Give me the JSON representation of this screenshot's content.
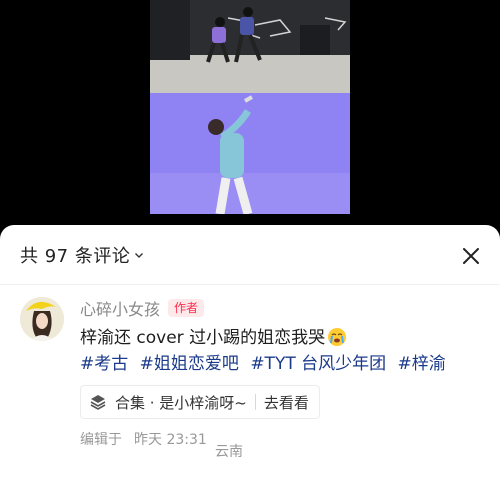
{
  "comments_header": {
    "count_label": "共 97 条评论",
    "dropdown_icon": "chevron-down-icon",
    "close_icon": "close-icon"
  },
  "comment": {
    "username": "心碎小女孩",
    "badge": "作者",
    "text": "梓渝还 cover 过小踢的姐恋我哭",
    "emoji": "crying-face",
    "tags": [
      "#考古",
      "#姐姐恋爱吧",
      "#TYT 台风少年团",
      "#梓渝"
    ],
    "collection": {
      "icon": "stack-icon",
      "label": "合集 · 是小梓渝呀~",
      "action": "去看看"
    },
    "meta": {
      "edited": "编辑于",
      "time": "昨天 23:31",
      "location": "云南"
    }
  },
  "colors": {
    "sheet_bg": "#ffffff",
    "tag": "#1b3a8a",
    "badge_text": "#ff2d4d",
    "badge_bg": "#fde8ea",
    "muted": "#999999"
  }
}
